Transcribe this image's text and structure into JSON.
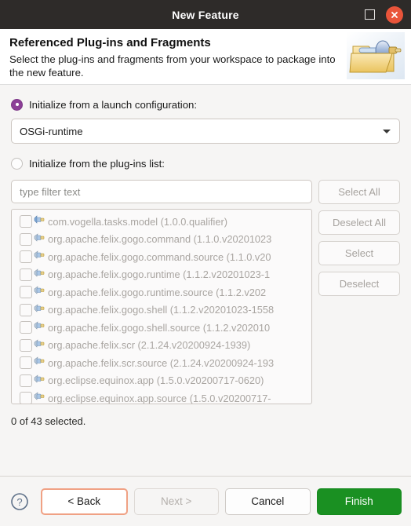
{
  "window": {
    "title": "New Feature",
    "maximize_icon": "maximize-icon",
    "close_icon": "close-icon"
  },
  "header": {
    "title": "Referenced Plug-ins and Fragments",
    "description": "Select the plug-ins and fragments from your workspace to package into the new feature.",
    "icon": "folder-plug-icon"
  },
  "options": {
    "launch_config": {
      "label": "Initialize from a launch configuration:",
      "selected": true
    },
    "plugins_list": {
      "label": "Initialize from the plug-ins list:",
      "selected": false
    }
  },
  "combo": {
    "value": "OSGi-runtime",
    "arrow_icon": "chevron-down-icon"
  },
  "filter": {
    "placeholder": "type filter text",
    "value": ""
  },
  "side_buttons": [
    {
      "label": "Select All",
      "enabled": false
    },
    {
      "label": "Deselect All",
      "enabled": false
    },
    {
      "label": "Select",
      "enabled": false
    },
    {
      "label": "Deselect",
      "enabled": false
    }
  ],
  "plugin_list": {
    "items": [
      {
        "label": "com.vogella.tasks.model (1.0.0.qualifier)",
        "checked": false,
        "icon": "plugin-icon"
      },
      {
        "label": "org.apache.felix.gogo.command (1.1.0.v20201023",
        "checked": false,
        "icon": "fragment-icon"
      },
      {
        "label": "org.apache.felix.gogo.command.source (1.1.0.v20",
        "checked": false,
        "icon": "fragment-icon"
      },
      {
        "label": "org.apache.felix.gogo.runtime (1.1.2.v20201023-1",
        "checked": false,
        "icon": "fragment-icon"
      },
      {
        "label": "org.apache.felix.gogo.runtime.source (1.1.2.v202",
        "checked": false,
        "icon": "fragment-icon"
      },
      {
        "label": "org.apache.felix.gogo.shell (1.1.2.v20201023-1558",
        "checked": false,
        "icon": "fragment-icon"
      },
      {
        "label": "org.apache.felix.gogo.shell.source (1.1.2.v202010",
        "checked": false,
        "icon": "fragment-icon"
      },
      {
        "label": "org.apache.felix.scr (2.1.24.v20200924-1939)",
        "checked": false,
        "icon": "fragment-icon"
      },
      {
        "label": "org.apache.felix.scr.source (2.1.24.v20200924-193",
        "checked": false,
        "icon": "fragment-icon"
      },
      {
        "label": "org.eclipse.equinox.app (1.5.0.v20200717-0620)",
        "checked": false,
        "icon": "fragment-icon"
      },
      {
        "label": "org.eclipse.equinox.app.source (1.5.0.v20200717-",
        "checked": false,
        "icon": "fragment-icon"
      }
    ]
  },
  "status": {
    "text": "0 of 43 selected."
  },
  "footer": {
    "help_icon": "help-icon",
    "buttons": [
      {
        "label": "< Back",
        "state": "focus"
      },
      {
        "label": "Next >",
        "state": "disabled"
      },
      {
        "label": "Cancel",
        "state": "normal"
      },
      {
        "label": "Finish",
        "state": "primary"
      }
    ]
  },
  "colors": {
    "titlebar_bg": "#2e2b29",
    "close_btn": "#e9543a",
    "accent_radio": "#8c3f97",
    "finish_green": "#1a9022",
    "focus_ring": "#f0a184",
    "body_bg": "#f6f5f4"
  }
}
